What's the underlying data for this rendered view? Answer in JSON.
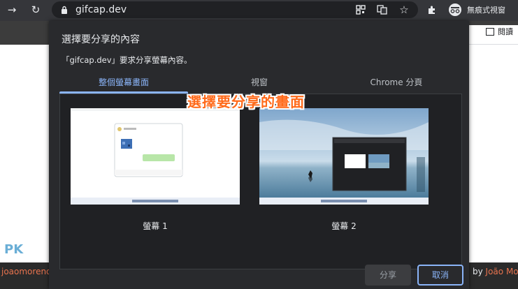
{
  "browser": {
    "url": "gifcap.dev",
    "incognito_label": "無痕式視窗",
    "reader_label": "閱讀"
  },
  "dialog": {
    "title": "選擇要分享的內容",
    "subtitle": "「gifcap.dev」要求分享螢幕內容。",
    "tabs": [
      {
        "label": "整個螢幕畫面",
        "active": true
      },
      {
        "label": "視窗",
        "active": false
      },
      {
        "label": "Chrome 分頁",
        "active": false
      }
    ],
    "screens": [
      {
        "label": "螢幕 1"
      },
      {
        "label": "螢幕 2"
      }
    ],
    "share_label": "分享",
    "cancel_label": "取消"
  },
  "annotation": "選擇要分享的畫面",
  "background": {
    "footer_left": "joaomoreno",
    "footer_right_prefix": "by ",
    "footer_right_name": "João Mo",
    "watermark": "PK"
  },
  "colors": {
    "accent": "#8ab4f8",
    "annotation": "#ff6a1a"
  }
}
